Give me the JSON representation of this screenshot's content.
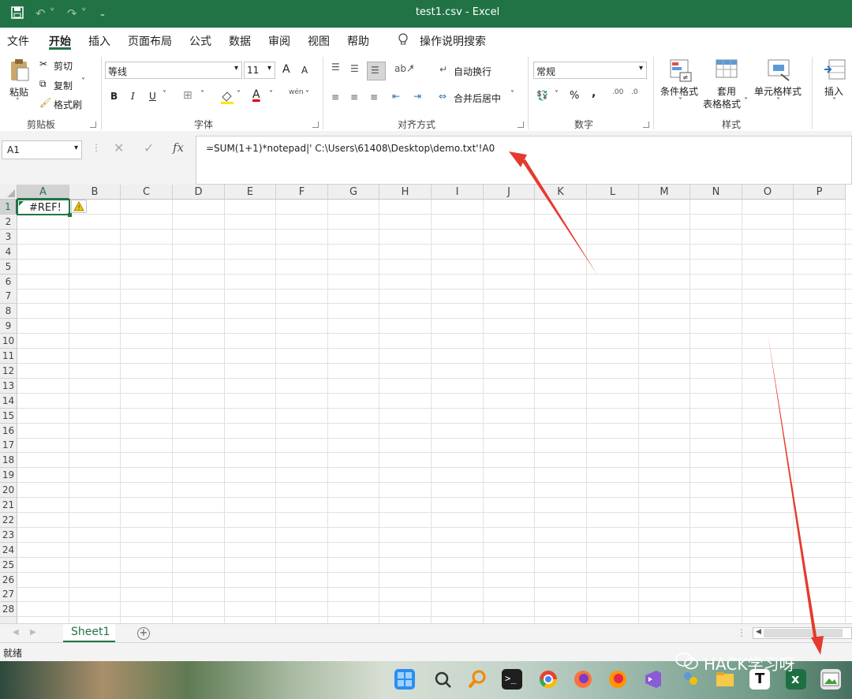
{
  "titlebar": {
    "title": "test1.csv  -  Excel",
    "save_icon": "save-icon",
    "undo_icon": "undo-icon",
    "redo_icon": "redo-icon",
    "customize_icon": "customize-qat-icon",
    "accent": "#217346"
  },
  "menu": {
    "tabs": [
      "文件",
      "开始",
      "插入",
      "页面布局",
      "公式",
      "数据",
      "审阅",
      "视图",
      "帮助"
    ],
    "active": "开始",
    "search_label": "操作说明搜索"
  },
  "ribbon": {
    "clipboard": {
      "paste": "粘贴",
      "cut": "剪切",
      "copy": "复制",
      "format_painter": "格式刷",
      "group": "剪贴板"
    },
    "font": {
      "name": "等线",
      "size": "11",
      "bold": "B",
      "italic": "I",
      "underline": "U",
      "grow": "A",
      "shrink": "A",
      "color": "A",
      "pinyin": "wén",
      "group": "字体"
    },
    "alignment": {
      "wrap": "自动换行",
      "merge": "合并后居中",
      "group": "对齐方式"
    },
    "number": {
      "format": "常规",
      "percent": "%",
      "comma": ",",
      "inc_dec": ".00",
      "group": "数字"
    },
    "styles": {
      "conditional": "条件格式",
      "table_1": "套用",
      "table_2": "表格格式",
      "cell_styles": "单元格样式",
      "group": "样式"
    },
    "cells": {
      "insert": "插入"
    }
  },
  "formula_bar": {
    "name_box": "A1",
    "fx": "fx",
    "formula": "=SUM(1+1)*notepad|' C:\\Users\\61408\\Desktop\\demo.txt'!A0"
  },
  "grid": {
    "columns": [
      "A",
      "B",
      "C",
      "D",
      "E",
      "F",
      "G",
      "H",
      "I",
      "J",
      "K",
      "L",
      "M",
      "N",
      "O",
      "P"
    ],
    "rows": [
      "1",
      "2",
      "3",
      "4",
      "5",
      "6",
      "7",
      "8",
      "9",
      "10",
      "11",
      "12",
      "13",
      "14",
      "15",
      "16",
      "17",
      "18",
      "19",
      "20",
      "21",
      "22",
      "23",
      "24",
      "25",
      "26",
      "27",
      "28"
    ],
    "cell_a1": "#REF!",
    "warning_icon": "error-warning-icon"
  },
  "sheets": {
    "tabs": [
      "Sheet1"
    ],
    "add": "+"
  },
  "status": {
    "text": "就绪"
  },
  "watermark": "HACK学习呀",
  "taskbar": {
    "icons": [
      "windows-start-icon",
      "search-icon",
      "magnifier-icon",
      "terminal-icon",
      "chrome-icon",
      "firefox-icon",
      "firefox-dev-icon",
      "visual-studio-icon",
      "people-icon",
      "file-explorer-icon",
      "typora-icon",
      "excel-icon",
      "image-viewer-icon"
    ]
  },
  "annotation_color": "#e53a2e"
}
